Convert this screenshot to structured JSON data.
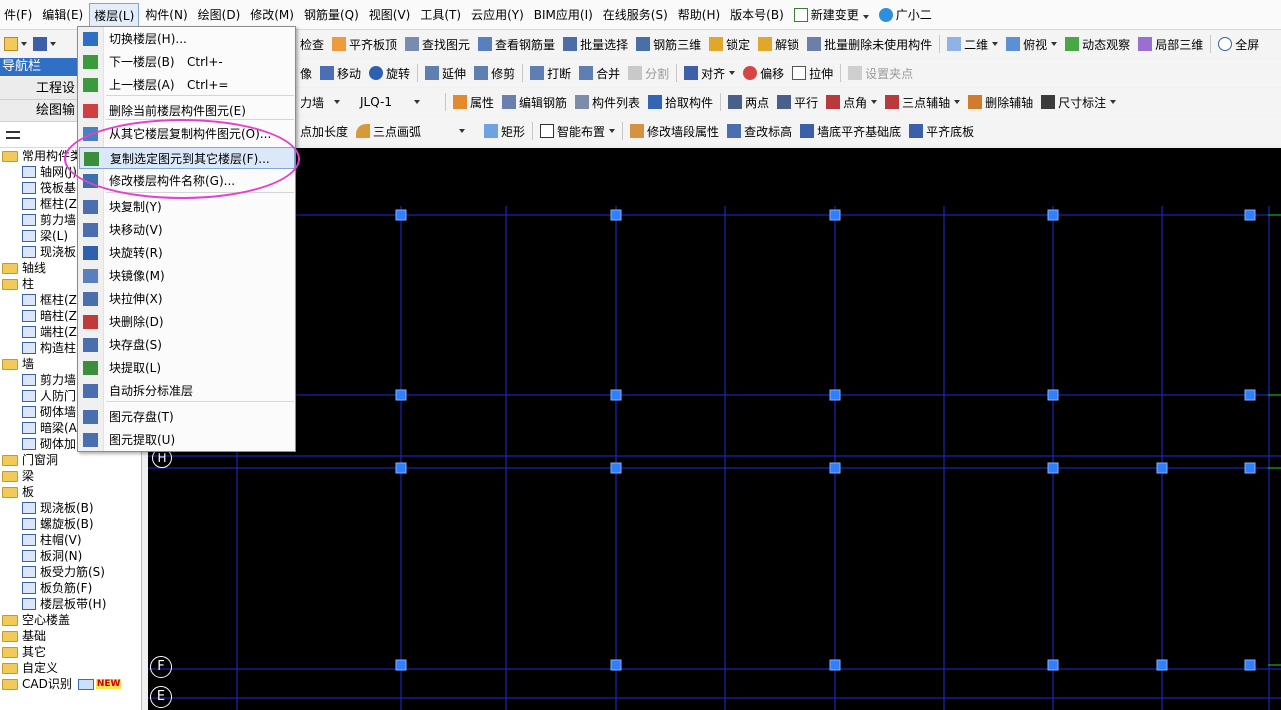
{
  "menubar": {
    "items": [
      "件(F)",
      "编辑(E)",
      "楼层(L)",
      "构件(N)",
      "绘图(D)",
      "修改(M)",
      "钢筋量(Q)",
      "视图(V)",
      "工具(T)",
      "云应用(Y)",
      "BIM应用(I)",
      "在线服务(S)",
      "帮助(H)",
      "版本号(B)"
    ],
    "new_change": "新建变更",
    "user": "广小二"
  },
  "toolbar1": {
    "items": [
      "检查",
      "平齐板顶",
      "查找图元",
      "查看钢筋量",
      "批量选择",
      "钢筋三维",
      "锁定",
      "解锁",
      "批量删除未使用构件",
      "二维",
      "俯视",
      "动态观察",
      "局部三维",
      "全屏"
    ]
  },
  "toolbar2": {
    "items": [
      "像",
      "移动",
      "旋转",
      "延伸",
      "修剪",
      "打断",
      "合并",
      "分割",
      "对齐",
      "偏移",
      "拉伸",
      "设置夹点"
    ]
  },
  "toolbar3": {
    "component_type": "力墙",
    "component_name": "JLQ-1",
    "items": [
      "属性",
      "编辑钢筋",
      "构件列表",
      "拾取构件",
      "两点",
      "平行",
      "点角",
      "三点辅轴",
      "删除辅轴",
      "尺寸标注"
    ]
  },
  "toolbar4": {
    "items": [
      "点加长度",
      "三点画弧",
      "矩形",
      "智能布置",
      "修改墙段属性",
      "查改标高",
      "墙底平齐基础底",
      "平齐底板"
    ]
  },
  "nav": {
    "title": "导航栏",
    "tab1": "工程设",
    "tab2": "绘图输",
    "tree": [
      {
        "level": 0,
        "label": "常用构件类",
        "type": "folder"
      },
      {
        "level": 1,
        "label": "轴网(J)",
        "type": "leaf"
      },
      {
        "level": 1,
        "label": "筏板基",
        "type": "leaf"
      },
      {
        "level": 1,
        "label": "框柱(Z",
        "type": "leaf"
      },
      {
        "level": 1,
        "label": "剪力墙",
        "type": "leaf"
      },
      {
        "level": 1,
        "label": "梁(L)",
        "type": "leaf"
      },
      {
        "level": 1,
        "label": "现浇板",
        "type": "leaf"
      },
      {
        "level": 0,
        "label": "轴线",
        "type": "folder"
      },
      {
        "level": 0,
        "label": "柱",
        "type": "folder"
      },
      {
        "level": 1,
        "label": "框柱(Z",
        "type": "leaf"
      },
      {
        "level": 1,
        "label": "暗柱(Z",
        "type": "leaf"
      },
      {
        "level": 1,
        "label": "端柱(Z",
        "type": "leaf"
      },
      {
        "level": 1,
        "label": "构造柱",
        "type": "leaf"
      },
      {
        "level": 0,
        "label": "墙",
        "type": "folder"
      },
      {
        "level": 1,
        "label": "剪力墙",
        "type": "leaf"
      },
      {
        "level": 1,
        "label": "人防门",
        "type": "leaf"
      },
      {
        "level": 1,
        "label": "砌体墙",
        "type": "leaf"
      },
      {
        "level": 1,
        "label": "暗梁(A",
        "type": "leaf"
      },
      {
        "level": 1,
        "label": "砌体加",
        "type": "leaf"
      },
      {
        "level": 0,
        "label": "门窗洞",
        "type": "folder"
      },
      {
        "level": 0,
        "label": "梁",
        "type": "folder"
      },
      {
        "level": 0,
        "label": "板",
        "type": "folder"
      },
      {
        "level": 1,
        "label": "现浇板(B)",
        "type": "leaf"
      },
      {
        "level": 1,
        "label": "螺旋板(B)",
        "type": "leaf"
      },
      {
        "level": 1,
        "label": "柱帽(V)",
        "type": "leaf"
      },
      {
        "level": 1,
        "label": "板洞(N)",
        "type": "leaf"
      },
      {
        "level": 1,
        "label": "板受力筋(S)",
        "type": "leaf"
      },
      {
        "level": 1,
        "label": "板负筋(F)",
        "type": "leaf"
      },
      {
        "level": 1,
        "label": "楼层板带(H)",
        "type": "leaf"
      },
      {
        "level": 0,
        "label": "空心楼盖",
        "type": "folder"
      },
      {
        "level": 0,
        "label": "基础",
        "type": "folder"
      },
      {
        "level": 0,
        "label": "其它",
        "type": "folder"
      },
      {
        "level": 0,
        "label": "自定义",
        "type": "folder"
      },
      {
        "level": 0,
        "label": "CAD识别",
        "type": "folder",
        "badge": "NEW"
      }
    ]
  },
  "dropdown": {
    "items": [
      {
        "label": "切换楼层(H)...",
        "shortcut": ""
      },
      {
        "label": "下一楼层(B)",
        "shortcut": "Ctrl+-"
      },
      {
        "label": "上一楼层(A)",
        "shortcut": "Ctrl+="
      },
      {
        "label": "删除当前楼层构件图元(E)",
        "shortcut": ""
      },
      {
        "label": "从其它楼层复制构件图元(O)...",
        "shortcut": ""
      },
      {
        "label": "复制选定图元到其它楼层(F)...",
        "shortcut": ""
      },
      {
        "label": "修改楼层构件名称(G)...",
        "shortcut": ""
      },
      {
        "label": "块复制(Y)",
        "shortcut": ""
      },
      {
        "label": "块移动(V)",
        "shortcut": ""
      },
      {
        "label": "块旋转(R)",
        "shortcut": ""
      },
      {
        "label": "块镜像(M)",
        "shortcut": ""
      },
      {
        "label": "块拉伸(X)",
        "shortcut": ""
      },
      {
        "label": "块删除(D)",
        "shortcut": ""
      },
      {
        "label": "块存盘(S)",
        "shortcut": ""
      },
      {
        "label": "块提取(L)",
        "shortcut": ""
      },
      {
        "label": "自动拆分标准层",
        "shortcut": ""
      },
      {
        "label": "图元存盘(T)",
        "shortcut": ""
      },
      {
        "label": "图元提取(U)",
        "shortcut": ""
      }
    ]
  },
  "canvas": {
    "axis_labels": [
      "H",
      "F",
      "E"
    ],
    "colors": {
      "background": "#000000",
      "grid": "#1f2bd6",
      "column": "#2f7fff",
      "green": "#1bd01b",
      "label": "#ffffff"
    }
  }
}
